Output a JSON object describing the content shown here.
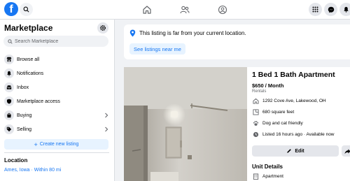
{
  "topbar": {
    "logo_letter": "f",
    "icons": [
      "search-icon",
      "home-icon",
      "friends-icon",
      "groups-icon",
      "menu-grid-icon",
      "messenger-icon",
      "notifications-bell-icon"
    ]
  },
  "sidebar": {
    "title": "Marketplace",
    "search_placeholder": "Search Marketplace",
    "items": [
      {
        "label": "Browse all",
        "icon": "storefront-icon"
      },
      {
        "label": "Notifications",
        "icon": "bell-icon"
      },
      {
        "label": "Inbox",
        "icon": "inbox-icon"
      },
      {
        "label": "Marketplace access",
        "icon": "shield-icon"
      },
      {
        "label": "Buying",
        "icon": "shopping-bag-icon",
        "has_chevron": true
      },
      {
        "label": "Selling",
        "icon": "tag-icon",
        "has_chevron": true
      }
    ],
    "create_listing": "Create new listing",
    "location_heading": "Location",
    "location_value": "Ames, Iowa · Within 80 mi"
  },
  "notice": {
    "text": "This listing is far from your current location.",
    "button": "See listings near me"
  },
  "listing": {
    "title": "1 Bed 1 Bath Apartment",
    "price": "$650 / Month",
    "category": "Rentals",
    "address": "1292 Cove Ave, Lakewood, OH",
    "size": "680 square feet",
    "pets": "Dog and cat friendly",
    "listed": "Listed 16 hours ago · Available now",
    "edit_button": "Edit",
    "unit_details_heading": "Unit Details",
    "unit_type": "Apartment"
  },
  "colors": {
    "accent": "#1877f2",
    "page_bg": "#f0f2f5",
    "button_grey": "#e4e6eb",
    "accent_light": "#e7f3ff"
  }
}
